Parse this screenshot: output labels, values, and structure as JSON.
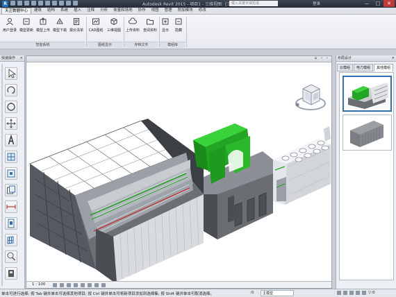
{
  "window": {
    "title": "Autodesk Revit 2015 - 项目1 - 三维视图: {三维}",
    "search_placeholder": "键入关键字或短语",
    "signin": "登录",
    "minimize": "—",
    "restore": "□",
    "close": "✕"
  },
  "tabs": [
    "天正数据中心",
    "建筑",
    "结构",
    "系统",
    "插入",
    "注释",
    "分析",
    "体量和场地",
    "协作",
    "视图",
    "管理",
    "附加模块",
    "修改"
  ],
  "ribbon": {
    "buttons": {
      "b0": "用户登录",
      "b1": "模型更新",
      "b2": "模型上传",
      "b3": "模型下载",
      "b4": "报价清单",
      "b5": "CAD图纸",
      "b6": "三维视图",
      "b7": "上传资料",
      "b8": "查阅资料",
      "b9": "显示",
      "b10": "隐藏"
    },
    "groups": {
      "g0": "智能系统",
      "g1": "图纸显示",
      "g2": "存档文件",
      "g3": "模组库"
    }
  },
  "left_panel": {
    "title": "快速操作",
    "close": "✕"
  },
  "viewport": {
    "controls": "⌂ ‹ ›",
    "scale": "1 : 100"
  },
  "right_panel": {
    "title": "布局设计",
    "close": "✕",
    "tabs": [
      "云模组",
      "电力模组",
      "其他模组"
    ]
  },
  "statusbar": {
    "message": "单击可进行选择; 按 Tab 键并单击可选择其他项目; 按 Ctrl 键并单击可将新项目添加到选择集; 按 Shift 键并单击可取消选择。",
    "count": ":0",
    "model": "主模型",
    "filter": "▽:0"
  },
  "colors": {
    "accent": "#2f6fb8",
    "green_unit": "#1fa51f",
    "titlebar": "#2f3643"
  },
  "icons": [
    "pointer-icon",
    "rotate-icon",
    "orbit-icon",
    "move-icon",
    "text-icon",
    "layout-icon",
    "align-icon",
    "copy-icon",
    "measure-icon",
    "sheet-icon",
    "grid-icon",
    "search-icon",
    "delete-icon",
    "view-cube-icon"
  ]
}
